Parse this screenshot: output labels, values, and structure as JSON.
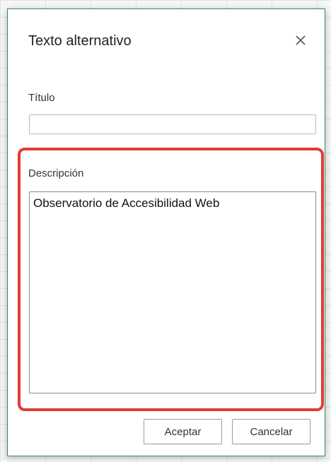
{
  "dialog": {
    "title": "Texto alternativo",
    "close_icon": "close-icon",
    "titulo_label": "Título",
    "titulo_value": "",
    "descripcion_label": "Descripción",
    "descripcion_value": "Observatorio de Accesibilidad Web",
    "ok_label": "Aceptar",
    "cancel_label": "Cancelar"
  },
  "colors": {
    "dialog_border": "#2f8f4e",
    "highlight": "#e53935"
  }
}
